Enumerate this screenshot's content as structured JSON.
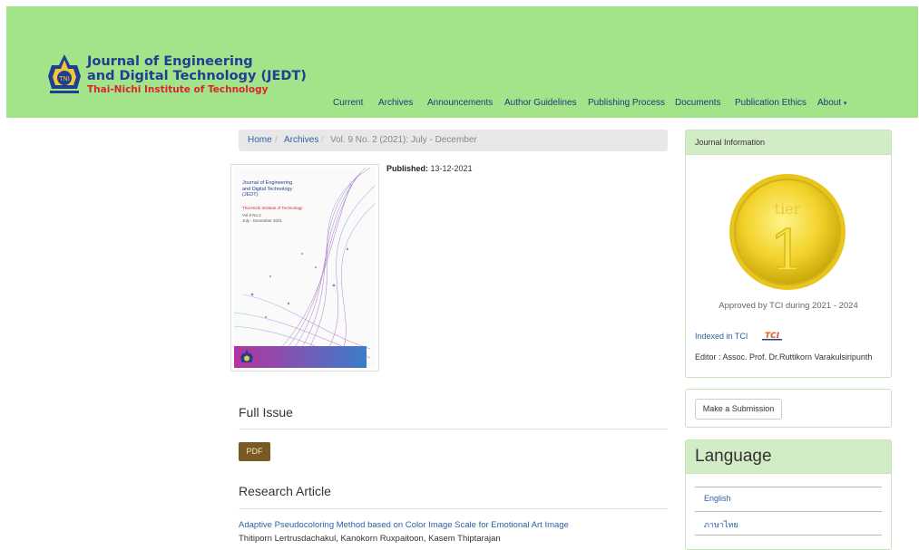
{
  "header": {
    "title_line1": "Journal of Engineering",
    "title_line2": "and Digital Technology (JEDT)",
    "subtitle": "Thai-Nichi Institute of Technology",
    "emblem_text": "TNI"
  },
  "nav": {
    "items": [
      "Current",
      "Archives",
      "Announcements",
      "Author Guidelines",
      "Publishing Process",
      "Documents",
      "Publication Ethics",
      "About"
    ],
    "about_caret": "▾"
  },
  "breadcrumb": {
    "home": "Home",
    "archives": "Archives",
    "separator": "/",
    "current": "Vol. 9 No. 2 (2021): July - December"
  },
  "cover": {
    "line1": "Journal of Engineering",
    "line2": "and Digital Technology",
    "line3": "(JEDT)",
    "institute": "Thai-Nichi Institute of Technology",
    "vol": "Vol.9 No.2",
    "period": "July - December 2021"
  },
  "published": {
    "label": "Published:",
    "date": "13-12-2021"
  },
  "full_issue": {
    "heading": "Full Issue",
    "pdf_label": "PDF"
  },
  "research": {
    "heading": "Research Article",
    "article_title": "Adaptive Pseudocoloring Method based on Color Image Scale for Emotional Art Image",
    "authors": "Thitiporn Lertrusdachakul, Kanokorn Ruxpaitoon, Kasem Thiptarajan"
  },
  "journal_info": {
    "heading": "Journal Information",
    "medal_word": "tier",
    "medal_number": "1",
    "approved": "Approved by TCI during 2021 - 2024",
    "indexed": "Indexed in TCI",
    "tci_logo_text": "TCI",
    "editor": "Editor : Assoc. Prof. Dr.Ruttikorn Varakulsiripunth"
  },
  "submission": {
    "button": "Make a Submission"
  },
  "language": {
    "heading": "Language",
    "items": [
      "English",
      "ภาษาไทย"
    ]
  },
  "colors": {
    "header_bg": "#a3e38a",
    "link": "#2e5fa5",
    "nav_text": "#1f3a7a",
    "pdf_bg": "#7a5a24",
    "panel_head": "#d2ecc6"
  }
}
